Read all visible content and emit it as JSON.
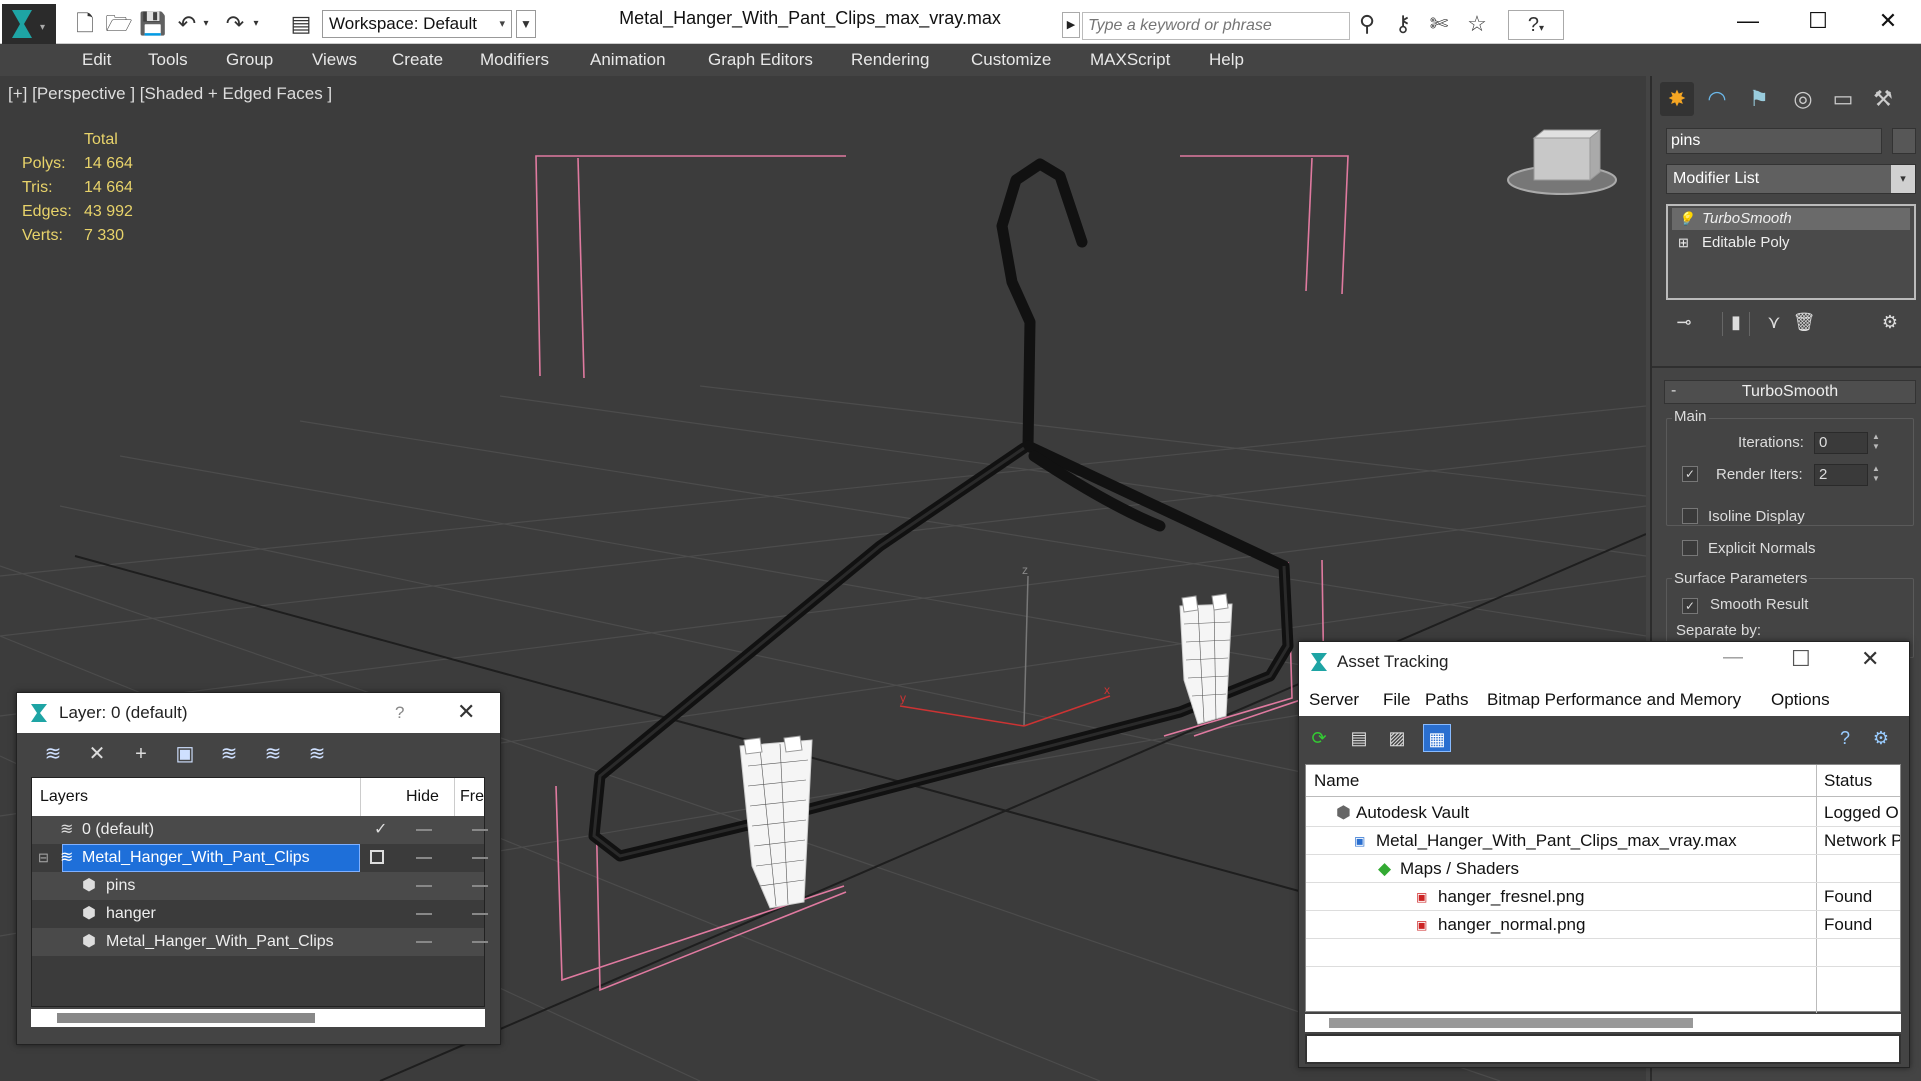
{
  "titlebar": {
    "workspace_label": "Workspace: Default",
    "document_title": "Metal_Hanger_With_Pant_Clips_max_vray.max",
    "search_placeholder": "Type a keyword or phrase",
    "help_label": "?"
  },
  "menu": {
    "items": [
      "Edit",
      "Tools",
      "Group",
      "Views",
      "Create",
      "Modifiers",
      "Animation",
      "Graph Editors",
      "Rendering",
      "Customize",
      "MAXScript",
      "Help"
    ]
  },
  "viewport": {
    "label": "[+] [Perspective ] [Shaded + Edged Faces ]",
    "stats": {
      "header": "Total",
      "rows": [
        {
          "label": "Polys:",
          "value": "14 664"
        },
        {
          "label": "Tris:",
          "value": "14 664"
        },
        {
          "label": "Edges:",
          "value": "43 992"
        },
        {
          "label": "Verts:",
          "value": "7 330"
        }
      ]
    },
    "axis_labels": {
      "z": "z",
      "x": "x",
      "y": "y"
    }
  },
  "command_panel": {
    "object_name": "pins",
    "modifier_list_label": "Modifier List",
    "stack": [
      "TurboSmooth",
      "Editable Poly"
    ],
    "rollout_title": "TurboSmooth",
    "rollout_toggle": "-",
    "main_group": "Main",
    "iterations_label": "Iterations:",
    "iterations_value": "0",
    "render_iters_label": "Render Iters:",
    "render_iters_value": "2",
    "render_iters_checked": true,
    "isoline_label": "Isoline Display",
    "explicit_normals_label": "Explicit Normals",
    "surface_group": "Surface Parameters",
    "smooth_result_label": "Smooth Result",
    "separate_by_label": "Separate by:"
  },
  "layer_dialog": {
    "title": "Layer: 0 (default)",
    "help": "?",
    "columns": {
      "layers": "Layers",
      "hide": "Hide",
      "freeze": "Fre"
    },
    "rows": [
      {
        "name": "0 (default)",
        "active": true
      },
      {
        "name": "Metal_Hanger_With_Pant_Clips",
        "selected": true
      },
      {
        "name": "pins"
      },
      {
        "name": "hanger"
      },
      {
        "name": "Metal_Hanger_With_Pant_Clips"
      }
    ]
  },
  "asset_dialog": {
    "title": "Asset Tracking",
    "menu": [
      "Server",
      "File",
      "Paths",
      "Bitmap Performance and Memory",
      "Options"
    ],
    "columns": {
      "name": "Name",
      "status": "Status"
    },
    "rows": [
      {
        "name": "Autodesk Vault",
        "status": "Logged O"
      },
      {
        "name": "Metal_Hanger_With_Pant_Clips_max_vray.max",
        "status": "Network P"
      },
      {
        "name": "Maps / Shaders",
        "status": ""
      },
      {
        "name": "hanger_fresnel.png",
        "status": "Found"
      },
      {
        "name": "hanger_normal.png",
        "status": "Found"
      }
    ]
  },
  "colors": {
    "accent_blue": "#1e6fd9",
    "stats_yellow": "#e8d36a",
    "bbox_pink": "#e07aa0",
    "viewport_bg": "#3c3c3c"
  }
}
